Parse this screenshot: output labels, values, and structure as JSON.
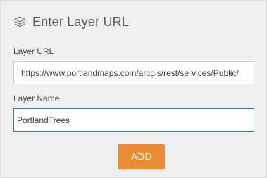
{
  "dialog": {
    "title": "Enter Layer URL",
    "title_icon": "layers-icon"
  },
  "layer_url": {
    "label": "Layer URL",
    "value": "https://www.portlandmaps.com/arcgis/rest/services/Public/"
  },
  "layer_name": {
    "label": "Layer Name",
    "value": "PortlandTrees"
  },
  "actions": {
    "add_label": "ADD"
  },
  "colors": {
    "panel_background": "#efefef",
    "add_button": "#e88c35",
    "focused_border": "#3f6e99",
    "title_text": "#5c5c5c"
  }
}
